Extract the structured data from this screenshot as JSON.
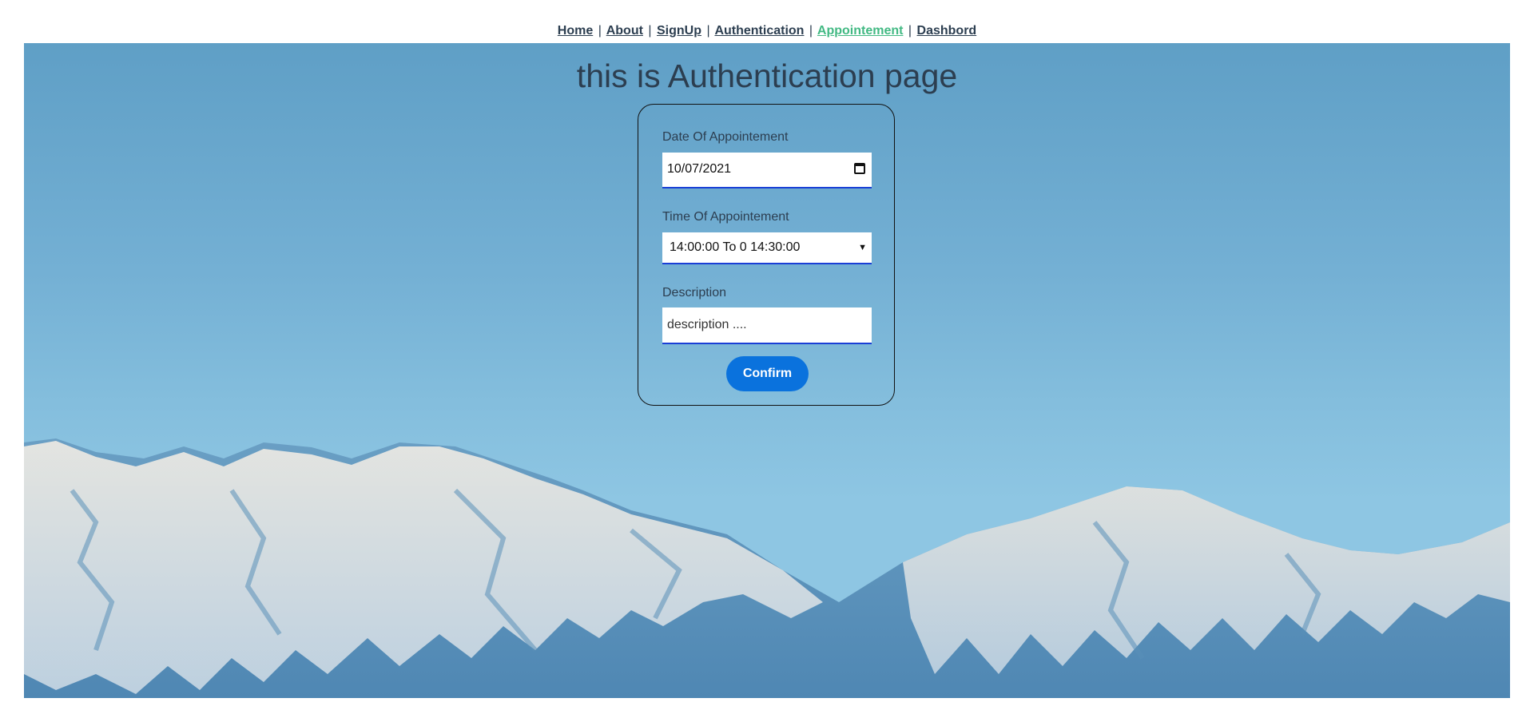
{
  "nav": {
    "items": [
      {
        "label": "Home"
      },
      {
        "label": "About"
      },
      {
        "label": "SignUp"
      },
      {
        "label": "Authentication"
      },
      {
        "label": "Appointement"
      },
      {
        "label": "Dashbord"
      }
    ],
    "separator": "|",
    "active": "Appointement",
    "active_color": "#42b983",
    "link_color": "#2c3e50"
  },
  "page": {
    "title": "this is Authentication page"
  },
  "form": {
    "date_label": "Date Of Appointement",
    "date_value": "10/07/2021",
    "date_icon": "calendar-icon",
    "time_label": "Time Of Appointement",
    "time_selected": "14:00:00 To 0 14:30:00",
    "time_icon": "chevron-down-icon",
    "description_label": "Description",
    "description_placeholder": "description ....",
    "confirm_label": "Confirm",
    "confirm_color": "#0a72dd"
  }
}
